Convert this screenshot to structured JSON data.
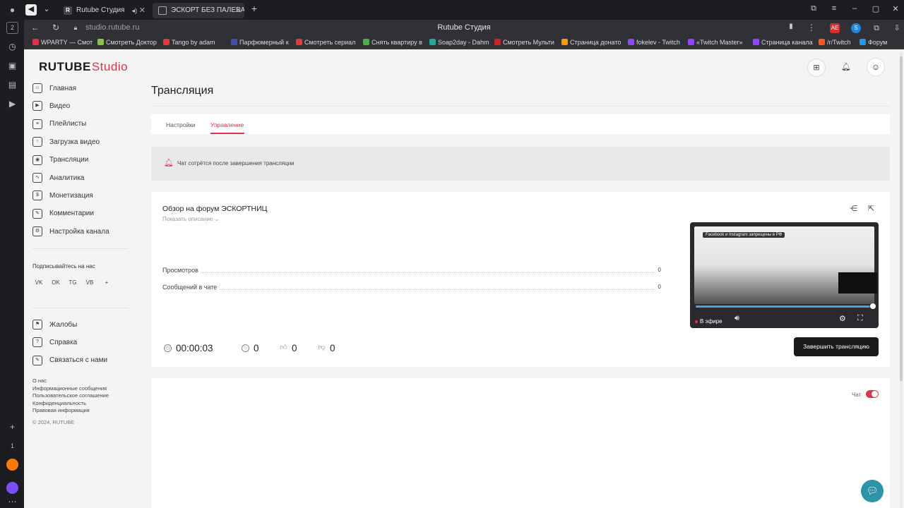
{
  "browser": {
    "tabs": [
      {
        "label": "Rutube Студия",
        "favicon": "R",
        "active": false
      },
      {
        "label": "ЭСКОРТ БЕЗ ПАЛЕВА",
        "favicon": "",
        "active": true
      }
    ],
    "url": "studio.rutube.ru",
    "page_title": "Rutube Студия",
    "rail_badges": [
      "2",
      "1"
    ],
    "bookmarks": [
      {
        "label": "WPARTY — Смот",
        "color": "#e0334d"
      },
      {
        "label": "Смотреть Доктор",
        "color": "#8bc34a"
      },
      {
        "label": "Tango by adam",
        "color": "#e53935"
      },
      {
        "label": "Парфюмерный к",
        "color": "#3f51b5"
      },
      {
        "label": "Смотреть сериал",
        "color": "#e53935"
      },
      {
        "label": "Снять квартиру в",
        "color": "#4caf50"
      },
      {
        "label": "Soap2day - Dahm",
        "color": "#26a69a"
      },
      {
        "label": "Смотреть Мульти",
        "color": "#c62828"
      },
      {
        "label": "Страница донато",
        "color": "#ff9800"
      },
      {
        "label": "fokelev - Twitch",
        "color": "#9146ff"
      },
      {
        "label": "«Twitch Master»",
        "color": "#9146ff"
      },
      {
        "label": "Страница канала",
        "color": "#9146ff"
      },
      {
        "label": "/r/Twitch",
        "color": "#ff5722"
      },
      {
        "label": "Форум",
        "color": "#2196f3"
      }
    ]
  },
  "brand": {
    "logo_main": "RUTUBE",
    "logo_studio": "Studio",
    "accent": "#e0334d"
  },
  "sidebar": {
    "items": [
      {
        "label": "Главная",
        "icon": "home-icon"
      },
      {
        "label": "Видео",
        "icon": "video-icon"
      },
      {
        "label": "Плейлисты",
        "icon": "playlist-icon"
      },
      {
        "label": "Загрузка видео",
        "icon": "upload-icon"
      },
      {
        "label": "Трансляции",
        "icon": "broadcast-icon"
      },
      {
        "label": "Аналитика",
        "icon": "analytics-icon"
      },
      {
        "label": "Монетизация",
        "icon": "money-icon"
      },
      {
        "label": "Комментарии",
        "icon": "comment-icon"
      },
      {
        "label": "Настройка канала",
        "icon": "settings-icon"
      }
    ],
    "subscribe_title": "Подписывайтесь на нас",
    "socials": [
      "VK",
      "OK",
      "TG",
      "VB",
      "+"
    ],
    "support_items": [
      {
        "label": "Жалобы",
        "icon": "flag-icon"
      },
      {
        "label": "Справка",
        "icon": "help-icon"
      },
      {
        "label": "Связаться с нами",
        "icon": "edit-icon"
      }
    ],
    "footer_links": [
      "О нас",
      "Информационные сообщения",
      "Пользовательское соглашение",
      "Конфиденциальность",
      "Правовая информация"
    ],
    "copyright": "© 2024, RUTUBE"
  },
  "main": {
    "title": "Трансляция",
    "tabs": [
      {
        "label": "Настройки",
        "active": false
      },
      {
        "label": "Управление",
        "active": true
      }
    ],
    "notice": "Чат сотрётся после завершения трансляции",
    "stream": {
      "title": "Обзор на форум ЭСКОРТНИЦ",
      "show_description": "Показать описание ⌄",
      "stats": [
        {
          "label": "Просмотров",
          "value": "0"
        },
        {
          "label": "Сообщений в чате",
          "value": "0"
        }
      ],
      "preview": {
        "banner": "Facebook и Instagram запрещены в РФ",
        "live_label": "В эфире",
        "progress": 0.98
      },
      "counters": {
        "duration": "00:00:03",
        "viewers": "0",
        "likes": "0",
        "dislikes": "0"
      },
      "end_button": "Завершить трансляцию"
    },
    "chat": {
      "label": "Чат",
      "enabled": true
    }
  }
}
